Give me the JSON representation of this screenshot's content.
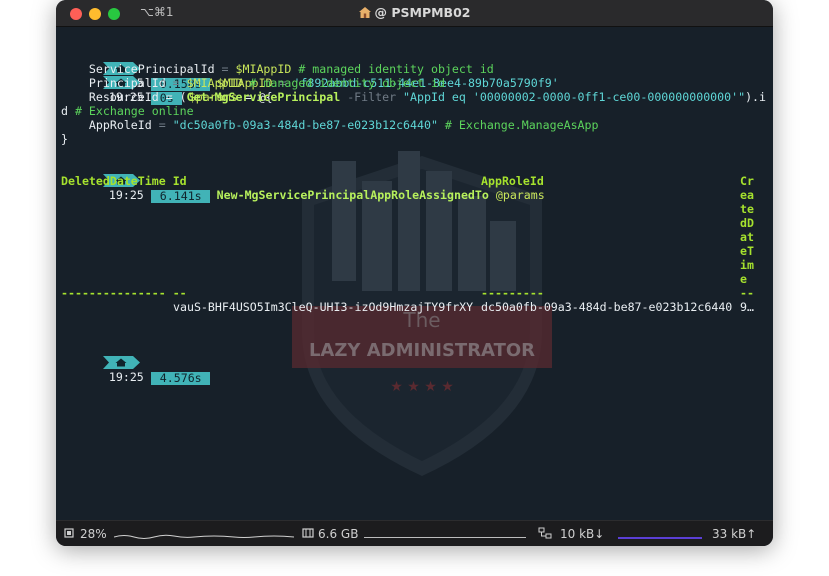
{
  "window": {
    "shortcut": "⌥⌘1",
    "title": "@ PSMPMB02"
  },
  "prompts": [
    {
      "time": "19:25",
      "duration": "0.158s"
    },
    {
      "time": "19:25",
      "duration": "0s"
    },
    {
      "time": "19:25",
      "duration": "6.141s"
    },
    {
      "time": "19:25",
      "duration": "4.576s"
    }
  ],
  "terminal": {
    "l1_var": "$MIAppID",
    "l1_eq": " = ",
    "l1_str": "'f892abbd-c511-44e1-8ee4-89b70a5790f9'",
    "l2_var": "$params",
    "l2_rest": " = @{",
    "l3_key": "    ServicePrincipalId",
    "l3_eq": " = ",
    "l3_var": "$MIAppID",
    "l3_cmt": " # managed identity object id",
    "l4_key": "    PrincipalId",
    "l4_eq": " = ",
    "l4_var": "$MIAppID",
    "l4_cmt": " # managed identity object id",
    "l5_key": "    ResourceId",
    "l5_eq": " = (",
    "l5_cmd": "Get-MgServicePrincipal",
    "l5_param": " -Filter ",
    "l5_str": "\"AppId eq '00000002-0000-0ff1-ce00-000000000000'\"",
    "l5_tail": ").i",
    "l6_pre": "d",
    "l6_cmt": " # Exchange online",
    "l7_key": "    AppRoleId",
    "l7_eq": " = ",
    "l7_str": "\"dc50a0fb-09a3-484d-be87-e023b12c6440\"",
    "l7_cmt": " # Exchange.ManageAsApp",
    "l8": "}",
    "cmd3": "New-MgServicePrincipalAppRoleAssignedTo",
    "cmd3_arg": " @params",
    "header_deleted": "DeletedDateTime",
    "header_id": "Id",
    "header_approle": "AppRoleId",
    "header_created_wrapped": [
      "Cr",
      "ea",
      "te",
      "dD",
      "at",
      "eT",
      "im",
      "e",
      "--"
    ],
    "sep_deleted": "---------------",
    "sep_id": "--",
    "sep_approle": "---------",
    "row_id": "vauS-BHF4USO5Im3CleQ-UHI3-izOd9HmzajTY9frXY",
    "row_approle": "dc50a0fb-09a3-484d-be87-e023b12c6440",
    "row_created": "9…"
  },
  "watermark": {
    "line1": "The",
    "line2": "LAZY ADMINISTRATOR"
  },
  "statusbar": {
    "cpu": "28%",
    "memory": "6.6 GB",
    "net_down": "10 kB↓",
    "net_up": "33 kB↑"
  },
  "colors": {
    "background": "#172029",
    "segment": "#41b3b7",
    "green": "#5cd45c",
    "string": "#5fd7d7"
  }
}
